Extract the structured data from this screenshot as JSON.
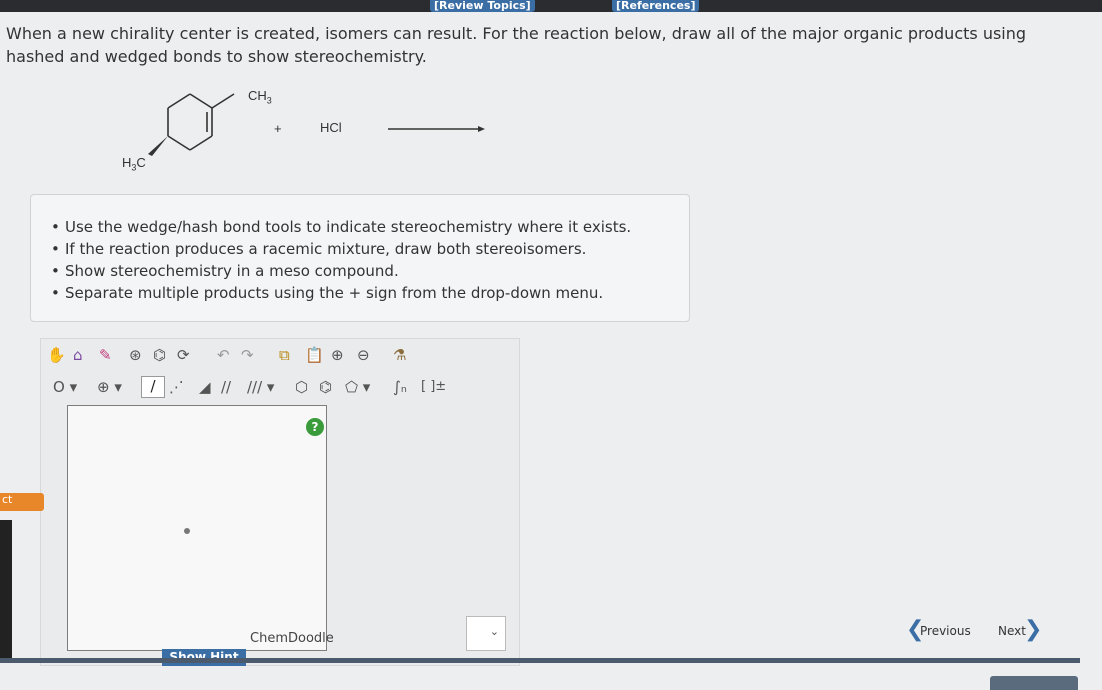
{
  "header": {
    "review_topics": "[Review Topics]",
    "references": "[References]"
  },
  "prompt": "When a new chirality center is created, isomers can result. For the reaction below, draw all of the major organic products using hashed and wedged bonds to show stereochemistry.",
  "reaction": {
    "ch3_top": "CH",
    "ch3_sub": "3",
    "h3c_left": "H",
    "h3c_sub": "3",
    "h3c_c": "C",
    "plus": "+",
    "reagent": "HCl"
  },
  "instructions": [
    "Use the wedge/hash bond tools to indicate stereochemistry where it exists.",
    "If the reaction produces a racemic mixture, draw both stereoisomers.",
    "Show stereochemistry in a meso compound.",
    "Separate multiple products using the + sign from the drop-down menu."
  ],
  "editor": {
    "brand": "ChemDoodle",
    "help": "?",
    "charge_label": "[ ]±"
  },
  "show_hint": "Show Hint",
  "nav": {
    "previous": "Previous",
    "next": "Next"
  },
  "side_tab": "ct",
  "colors": {
    "link_blue": "#3a6ea5",
    "orange_tab": "#e8862a",
    "help_green": "#3a9b3a"
  }
}
